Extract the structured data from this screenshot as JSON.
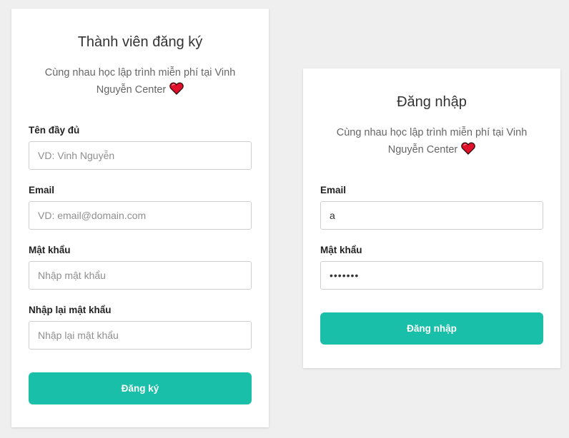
{
  "register": {
    "title": "Thành viên đăng ký",
    "subtitle": "Cùng nhau học lập trình miễn phí tại Vinh Nguyễn Center",
    "fields": [
      {
        "label": "Tên đầy đủ",
        "placeholder": "VD: Vinh Nguyễn",
        "value": ""
      },
      {
        "label": "Email",
        "placeholder": "VD: email@domain.com",
        "value": ""
      },
      {
        "label": "Mật khẩu",
        "placeholder": "Nhập mật khẩu",
        "value": ""
      },
      {
        "label": "Nhập lại mật khẩu",
        "placeholder": "Nhập lại mật khẩu",
        "value": ""
      }
    ],
    "submit_label": "Đăng ký"
  },
  "login": {
    "title": "Đăng nhập",
    "subtitle": "Cùng nhau học lập trình miễn phí tại Vinh Nguyễn Center",
    "fields": [
      {
        "label": "Email",
        "placeholder": "",
        "value": "a"
      },
      {
        "label": "Mật khẩu",
        "placeholder": "",
        "value": "•••••••"
      }
    ],
    "submit_label": "Đăng nhập"
  },
  "icons": {
    "heart": "heart-icon",
    "heart_color": "#e0102a"
  },
  "colors": {
    "accent": "#1abfa9",
    "background": "#efefef",
    "card": "#ffffff"
  }
}
